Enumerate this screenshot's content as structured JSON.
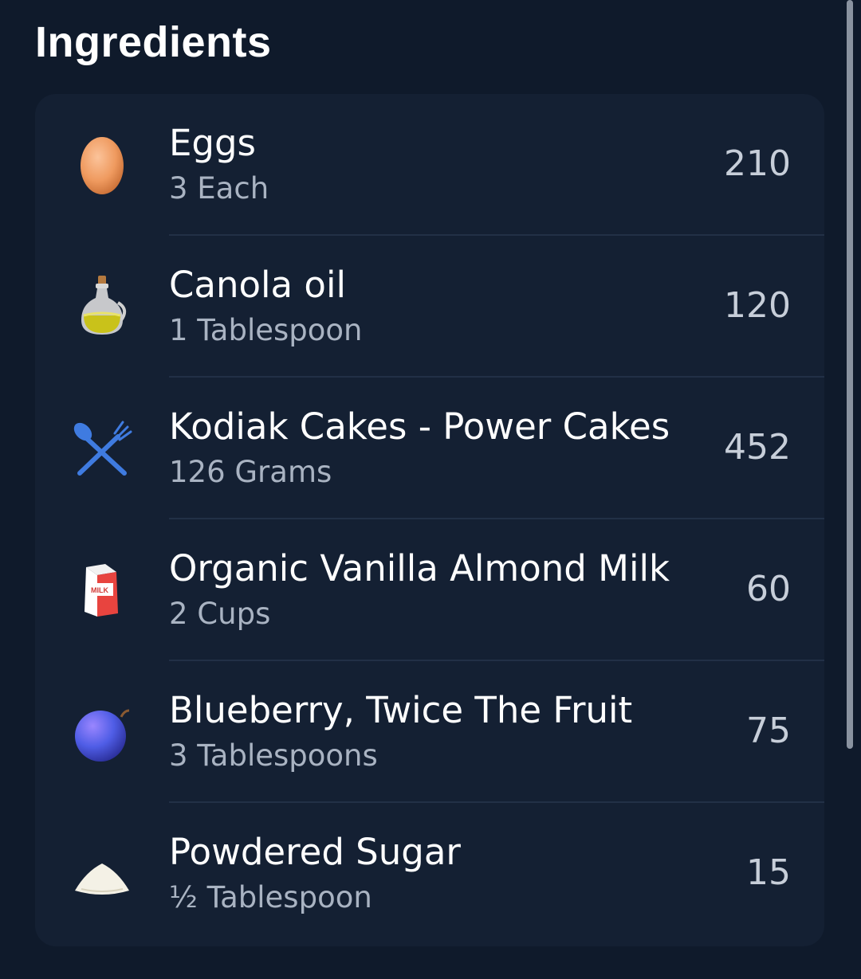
{
  "header": {
    "title": "Ingredients"
  },
  "ingredients": [
    {
      "name": "Eggs",
      "amount": "3 Each",
      "calories": "210",
      "icon": "egg-icon"
    },
    {
      "name": "Canola oil",
      "amount": "1 Tablespoon",
      "calories": "120",
      "icon": "oil-bottle-icon"
    },
    {
      "name": "Kodiak Cakes - Power Cakes",
      "amount": "126 Grams",
      "calories": "452",
      "icon": "fork-knife-icon"
    },
    {
      "name": "Organic Vanilla Almond Milk",
      "amount": "2 Cups",
      "calories": "60",
      "icon": "milk-carton-icon",
      "icon_text": "MILK"
    },
    {
      "name": "Blueberry, Twice The Fruit",
      "amount": "3 Tablespoons",
      "calories": "75",
      "icon": "blueberry-icon"
    },
    {
      "name": "Powdered Sugar",
      "amount": "½ Tablespoon",
      "calories": "15",
      "icon": "sugar-pile-icon"
    }
  ],
  "colors": {
    "background": "#0f1a2b",
    "card": "#142033",
    "divider": "#223046",
    "primary_text": "#ffffff",
    "secondary_text": "#a9b3c2",
    "fork_knife_blue": "#3f7be0"
  }
}
